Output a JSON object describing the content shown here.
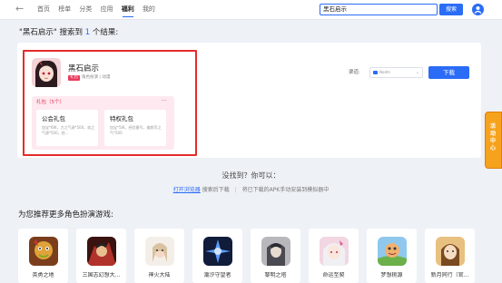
{
  "topbar": {
    "back_icon": "arrow-left-icon",
    "nav": [
      "首页",
      "榜单",
      "分类",
      "应用",
      "福利",
      "我的"
    ],
    "active_nav": "福利",
    "search_value": "黑石启示",
    "search_button": "搜索",
    "user_icon": "user-icon",
    "accent": "#2a6cf6"
  },
  "result": {
    "prefix": "\"黑石启示\" 搜索到",
    "count": "1",
    "suffix": "个结果:"
  },
  "game": {
    "name": "黑石启示",
    "tag": "礼包",
    "tag_text": "角色扮演 | 动漫",
    "channel_label": "渠道:",
    "channel_value": "Nodm",
    "download": "下载",
    "gift_title": "礼包（5个）",
    "gift_more": "···",
    "gifts": [
      {
        "name": "公会礼包",
        "desc": "加宝*6W，力之气源*500，攻之气源*500，经..."
      },
      {
        "name": "特权礼包",
        "desc": "加宝*5W，经验番号，美颜币之气*500"
      }
    ]
  },
  "benefit_label": "活动中心",
  "not_found": {
    "title": "没找到？你可以：",
    "link": "打开浏览器",
    "link_suffix": "搜索后下载",
    "separator": "|",
    "alt": "将已下载的APK手动安装到模拟器中"
  },
  "recommend": {
    "title": "为您推荐更多角色扮演游戏:",
    "items": [
      "英勇之地",
      "三国志幻想大...",
      "神火大陆",
      "潮汐守望者",
      "黎明之塔",
      "命运至契",
      "梦想桃源",
      "新月同行（官..."
    ]
  }
}
